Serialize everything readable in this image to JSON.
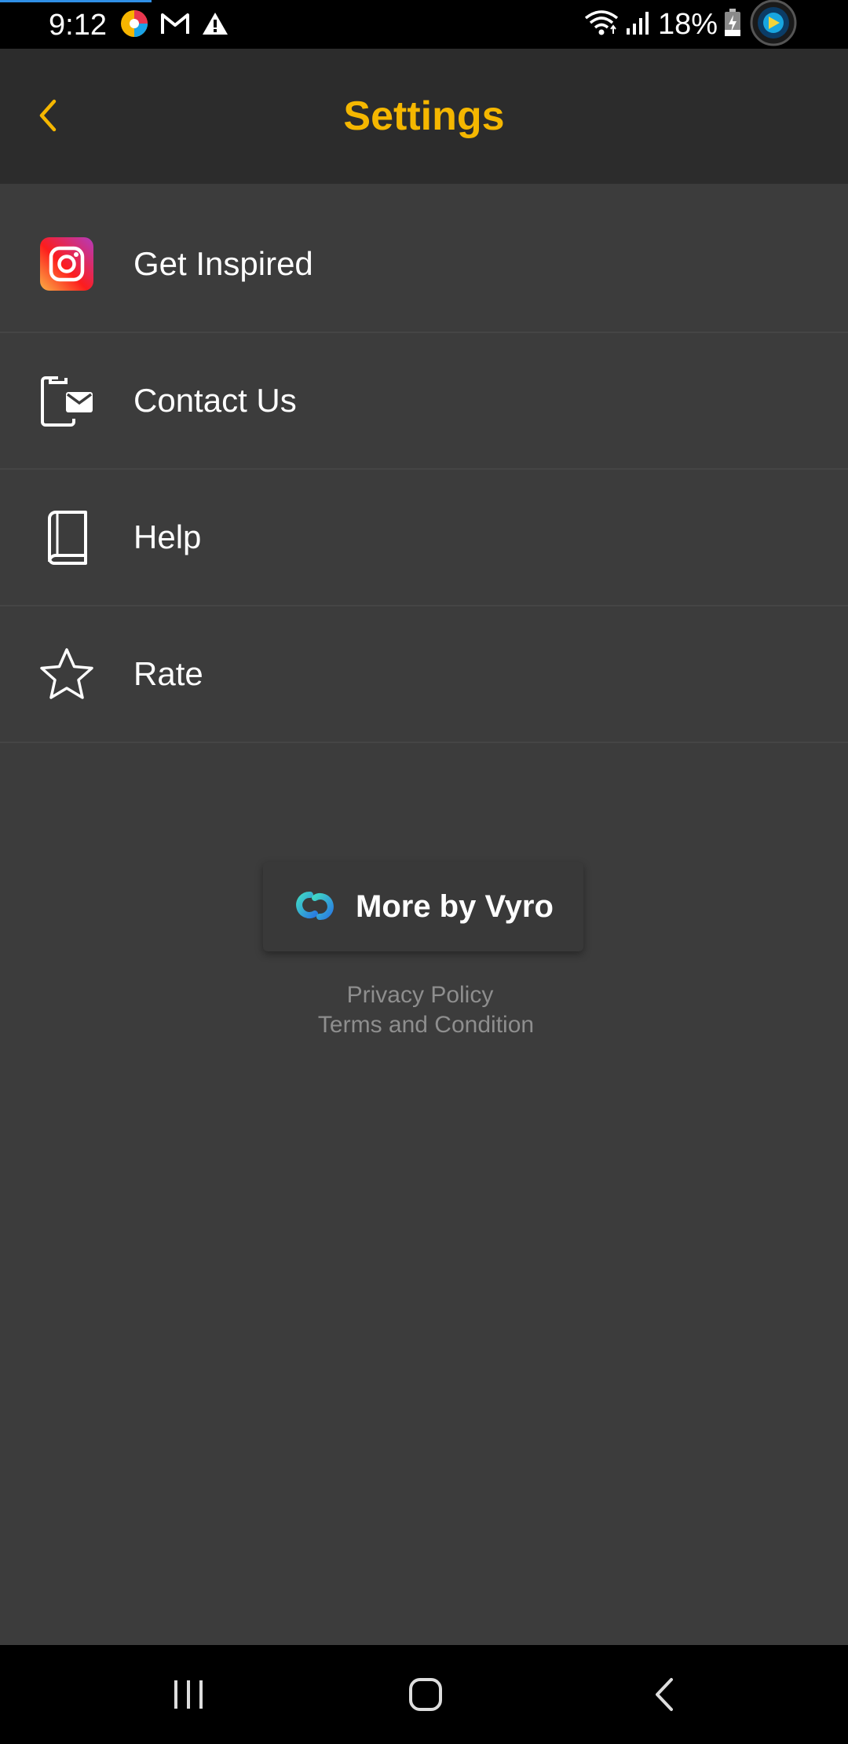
{
  "status_bar": {
    "time": "9:12",
    "battery": "18%",
    "icons": [
      "color-app-icon",
      "gmail-icon",
      "warning-icon",
      "wifi-icon",
      "signal-icon",
      "battery-charging-icon",
      "app-bubble-icon"
    ]
  },
  "header": {
    "title": "Settings",
    "back_icon": "chevron-left-icon"
  },
  "settings": {
    "items": [
      {
        "label": "Get Inspired",
        "icon": "instagram-icon"
      },
      {
        "label": "Contact Us",
        "icon": "contact-mail-icon"
      },
      {
        "label": "Help",
        "icon": "book-icon"
      },
      {
        "label": "Rate",
        "icon": "star-icon"
      }
    ]
  },
  "footer": {
    "more_button_label": "More by Vyro",
    "privacy_link": "Privacy Policy",
    "terms_link": "Terms and Condition"
  },
  "navigation": {
    "buttons": [
      "recent-apps-icon",
      "home-icon",
      "back-icon"
    ]
  },
  "colors": {
    "accent": "#f5b700",
    "background": "#3c3c3c",
    "header_background": "#2c2c2c",
    "link_text": "#8e8e8e"
  }
}
